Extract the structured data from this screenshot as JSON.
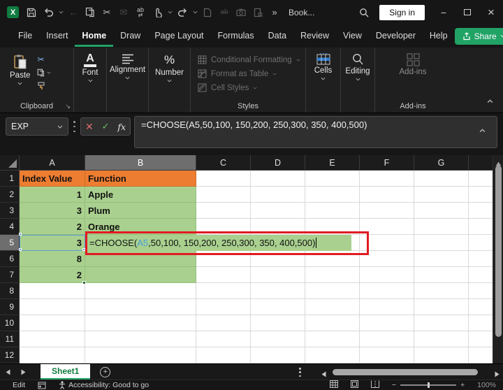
{
  "titlebar": {
    "workbook_name": "Book...",
    "sign_in": "Sign in",
    "more_commands": "»"
  },
  "tabs": {
    "items": [
      "File",
      "Insert",
      "Home",
      "Draw",
      "Page Layout",
      "Formulas",
      "Data",
      "Review",
      "View",
      "Developer",
      "Help"
    ],
    "active": "Home",
    "share": "Share"
  },
  "ribbon": {
    "paste": "Paste",
    "font": "Font",
    "alignment": "Alignment",
    "number": "Number",
    "conditional_formatting": "Conditional Formatting",
    "format_as_table": "Format as Table",
    "cell_styles": "Cell Styles",
    "cells": "Cells",
    "editing": "Editing",
    "addins_button": "Add-ins",
    "group_clipboard": "Clipboard",
    "group_styles": "Styles",
    "group_addins": "Add-ins"
  },
  "formula_bar": {
    "name_box": "EXP",
    "formula": "=CHOOSE(A5,50,100, 150,200, 250,300, 350, 400,500)"
  },
  "grid": {
    "columns": [
      "A",
      "B",
      "C",
      "D",
      "E",
      "F",
      "G"
    ],
    "selected_column": "B",
    "selected_row": "5",
    "rows": [
      {
        "n": "1",
        "a": "Index Value",
        "b": "Function"
      },
      {
        "n": "2",
        "a": "1",
        "b": "Apple"
      },
      {
        "n": "3",
        "a": "3",
        "b": "Plum"
      },
      {
        "n": "4",
        "a": "2",
        "b": "Orange"
      },
      {
        "n": "5",
        "a": "3",
        "b": ""
      },
      {
        "n": "6",
        "a": "8",
        "b": ""
      },
      {
        "n": "7",
        "a": "2",
        "b": ""
      },
      {
        "n": "8"
      },
      {
        "n": "9"
      },
      {
        "n": "10"
      },
      {
        "n": "11"
      },
      {
        "n": "12"
      }
    ],
    "formula_cell": {
      "prefix": "=CHOOSE(",
      "ref": "A5",
      "suffix": ",50,100, 150,200, 250,300, 350, 400,500)"
    }
  },
  "sheet_bar": {
    "sheet_name": "Sheet1"
  },
  "status_bar": {
    "mode": "Edit",
    "accessibility": "Accessibility: Good to go",
    "zoom_level": "100%"
  },
  "colors": {
    "accent_green": "#21A366",
    "header_orange": "#ED7D31",
    "cell_green": "#A9D08E",
    "annotation_red": "#E11B22",
    "reference_blue": "#5B9BD5"
  }
}
